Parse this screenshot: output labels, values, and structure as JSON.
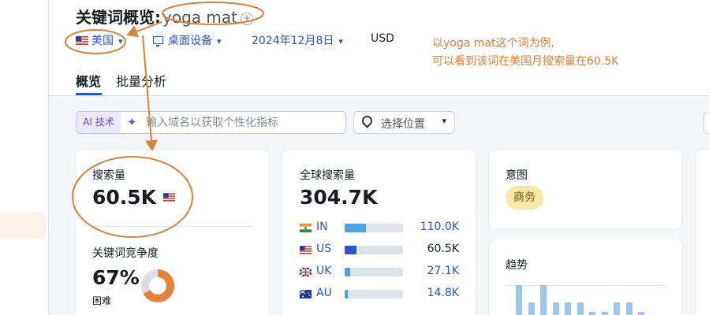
{
  "header": {
    "title": "关键词概览:",
    "keyword": "yoga mat",
    "add_icon": "plus-circle-icon"
  },
  "filters": {
    "country": "美国",
    "device": "桌面设备",
    "date": "2024年12月8日",
    "currency": "USD"
  },
  "tabs": [
    {
      "label": "概览",
      "active": true
    },
    {
      "label": "批量分析",
      "active": false
    }
  ],
  "annotation": {
    "line1": "以yoga mat这个词为例,",
    "line2": "可以看到该词在美国月搜索量在60.5K",
    "color": "#d9823b"
  },
  "ai_bar": {
    "tag": "AI 技术",
    "placeholder": "输入域名以获取个性化指标"
  },
  "location_select": {
    "label": "选择位置"
  },
  "volume_card": {
    "label": "搜索量",
    "value": "60.5K"
  },
  "difficulty_card": {
    "label": "关键词竞争度",
    "value": "67%",
    "level": "困难",
    "percent": 67
  },
  "global_card": {
    "label": "全球搜索量",
    "value": "304.7K",
    "rows": [
      {
        "code": "IN",
        "value": "110.0K",
        "share": 0.36
      },
      {
        "code": "US",
        "value": "60.5K",
        "share": 0.2
      },
      {
        "code": "UK",
        "value": "27.1K",
        "share": 0.09
      },
      {
        "code": "AU",
        "value": "14.8K",
        "share": 0.05
      }
    ]
  },
  "intent_card": {
    "label": "意图",
    "badge": "商务"
  },
  "trend_card": {
    "label": "趋势",
    "bars": [
      0.95,
      0.4,
      0.95,
      0.4,
      0.4,
      0.4,
      0.1,
      0.1,
      0.4,
      0.4,
      0.1
    ]
  },
  "colors": {
    "accent": "#2b56c9",
    "annotation": "#d9823b"
  }
}
